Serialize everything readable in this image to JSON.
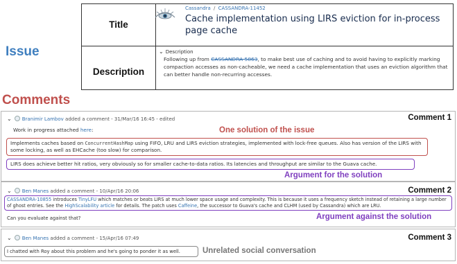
{
  "labels": {
    "issue": "Issue",
    "comments": "Comments"
  },
  "issue": {
    "title_label": "Title",
    "description_label": "Description",
    "logo_icon": "eye-logo-icon",
    "breadcrumb": {
      "project": "Cassandra",
      "separator": "/",
      "key": "CASSANDRA-11452"
    },
    "title": "Cache implementation using LIRS eviction for in-process page cache",
    "description_toggle": "Description",
    "description": {
      "before_link": "Following up from ",
      "link": "CASSANDRA-5863",
      "after_link": ", to make best use of caching and to avoid having to explicitly marking compaction accesses as non-cacheable, we need a cache implementation that uses an eviction algorithm that can better handle non-recurring accesses."
    }
  },
  "comments": [
    {
      "tag": "Comment 1",
      "author": "Branimir Lambov",
      "meta": " added a comment - 31/Mar/16 16:45 - edited",
      "lines": {
        "wip_prefix": "Work in progress attached ",
        "wip_link": "here",
        "wip_suffix": ":",
        "solution_a": "Implements caches based on ",
        "solution_code": "ConcurrentHashMap",
        "solution_b": " using FIFO, LRU and LIRS eviction strategies, implemented with lock-free queues. Also has version of the LIRS with some locking, as well as EHCache (too slow) for comparison.",
        "argument": "LIRS does achieve better hit ratios, very obviously so for smaller cache-to-data ratios. Its latencies and throughput are similar to the Guava cache."
      },
      "annotations": {
        "solution": "One solution of the issue",
        "argument_for": "Argument for the solution"
      }
    },
    {
      "tag": "Comment 2",
      "author": "Ben Manes",
      "meta": " added a comment - 10/Apr/16 20:06",
      "lines": {
        "p1_link1": "CASSANDRA-10855",
        "p1_a": " introduces ",
        "p1_link2": "TinyLFU",
        "p1_b": " which matches or beats LIRS at much lower space usage and complexity. This is because it uses a frequency sketch instead of retaining a large number of ghost entries. See the ",
        "p1_link3": "HighScalability article",
        "p1_c": " for details. The patch uses ",
        "p1_link4": "Caffeine",
        "p1_d": ", the successor to Guava's cache and CLHM (used by Cassandra) which are LRU.",
        "question": "Can you evaluate against that?"
      },
      "annotations": {
        "argument_against": "Argument against the solution"
      }
    },
    {
      "tag": "Comment 3",
      "author": "Ben Manes",
      "meta": " added a comment - 15/Apr/16 07:49",
      "lines": {
        "social": "I chatted with Roy about this problem and he's going to ponder it as well."
      },
      "annotations": {
        "unrelated": "Unrelated social conversation"
      }
    }
  ],
  "colors": {
    "issue_label": "#3f7fbf",
    "comments_label": "#c0504d",
    "solution_box": "#c0504d",
    "argument_box": "#7f3fbf",
    "link": "#3572b0"
  }
}
